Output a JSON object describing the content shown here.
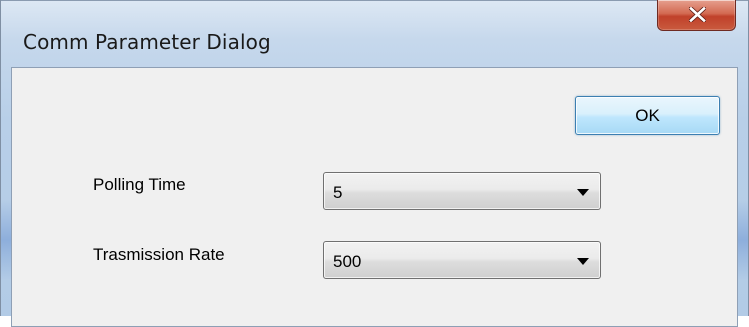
{
  "window": {
    "title": "Comm Parameter Dialog",
    "close_icon": "close-icon"
  },
  "dialog": {
    "ok_label": "OK",
    "fields": [
      {
        "label": "Polling Time",
        "value": "5"
      },
      {
        "label": "Trasmission Rate",
        "value": "500"
      }
    ]
  },
  "colors": {
    "close_button": "#c9462f",
    "ok_border": "#3c7fb1",
    "client_bg": "#f0f0f0"
  }
}
